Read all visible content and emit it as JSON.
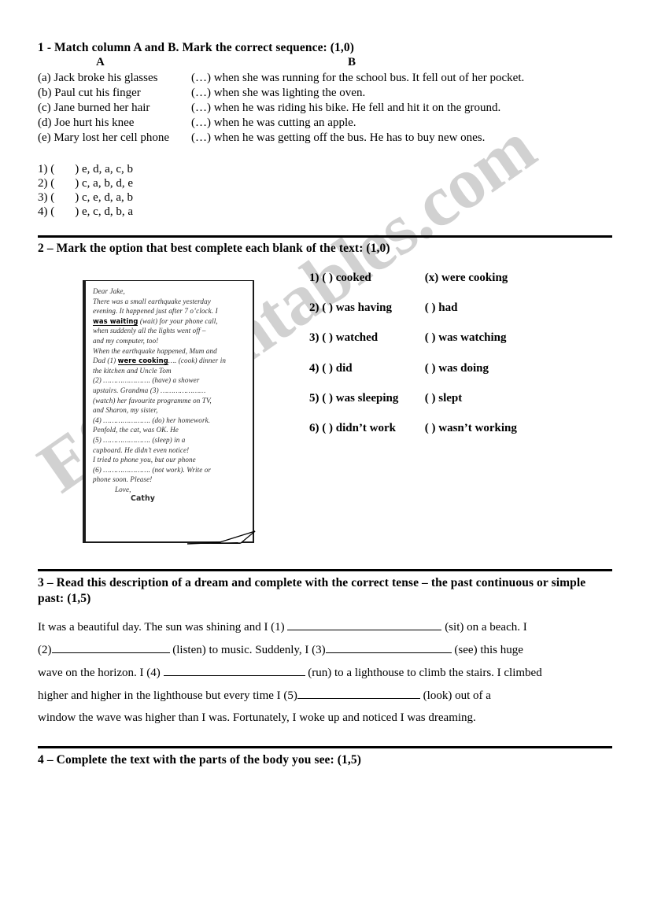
{
  "watermark": {
    "text": "ESLprintables.com"
  },
  "exercise1": {
    "heading": "1 - Match column A and B. Mark the correct sequence: (1,0)",
    "column_a_label": "A",
    "column_b_label": "B",
    "column_a": [
      "(a) Jack broke his glasses",
      "(b) Paul cut his finger",
      "(c) Jane burned her hair",
      "(d) Joe hurt his knee",
      "(e) Mary lost her cell phone"
    ],
    "column_b": [
      "(…) when she was running for the school bus. It fell out of her pocket.",
      "(…) when she was lighting the oven.",
      "(…) when he was riding his bike. He fell and hit it on the ground.",
      "(…) when he was cutting an apple.",
      "(…) when he was getting off the bus. He has to buy new ones."
    ],
    "sequences": [
      {
        "number": "1) (",
        "close": ")",
        "answer": "e, d, a, c, b"
      },
      {
        "number": "2) (",
        "close": ")",
        "answer": "c, a, b, d, e"
      },
      {
        "number": "3) (",
        "close": ")",
        "answer": "c, e, d, a, b"
      },
      {
        "number": "4) (",
        "close": ")",
        "answer": "e, c, d, b, a"
      }
    ]
  },
  "exercise2": {
    "heading": "2 – Mark the option that best complete each blank of the text: (1,0)",
    "letter": {
      "greeting": "Dear Jake,",
      "lines": [
        "There was a small earthquake yesterday",
        "evening. It happened just after 7 o’clock. I"
      ],
      "filled_answer_1": "was waiting",
      "line_after_fill": "(wait) for your phone call,",
      "lines2": [
        "when suddenly all the lights went off –",
        "and my computer, too!",
        "When the earthquake happened, Mum and"
      ],
      "blank1_prefix": "Dad (1)",
      "blank1_answer": "were cooking",
      "blank1_suffix": "…. (cook) dinner in",
      "lines3": [
        "the kitchen and Uncle Tom",
        "(2) …………………. (have) a shower",
        "upstairs. Grandma (3) …………………",
        "(watch) her favourite programme on TV,",
        "and Sharon, my sister,",
        "(4) …………………. (do) her homework.",
        "Penfold, the cat, was OK. He",
        "(5) …………………. (sleep) in a",
        "cupboard. He didn’t even notice!",
        "I tried to phone you, but our phone",
        "(6) …………………. (not work). Write or",
        "phone soon. Please!"
      ],
      "closing": "Love,",
      "signature": "Cathy"
    },
    "options": [
      {
        "number": "1) (",
        "first": ") cooked",
        "second": "(x) were cooking"
      },
      {
        "number": "2) (",
        "first": ") was having",
        "second": "(            ) had"
      },
      {
        "number": "3) (",
        "first": ") watched",
        "second": "(            ) was watching"
      },
      {
        "number": "4) (",
        "first": ") did",
        "second": "(            ) was doing"
      },
      {
        "number": "5) (",
        "first": ") was sleeping",
        "second": "(            ) slept"
      },
      {
        "number": "6) (",
        "first": ") didn’t work",
        "second": "(            ) wasn’t working"
      }
    ]
  },
  "exercise3": {
    "heading": "3 – Read this description of a dream and complete with the correct tense – the past continuous or simple past: (1,5)",
    "line1_a": "It was a beautiful day. The sun was shining and I (1)",
    "line1_b": "(sit) on a beach. I",
    "line2_a": "(2)",
    "line2_b": "(listen) to music. Suddenly, I (3)",
    "line2_c": "(see) this huge",
    "line3_a": "wave on the horizon. I (4)",
    "line3_b": "(run) to a lighthouse to climb the stairs. I climbed",
    "line4_a": "higher and higher in the lighthouse but every time I (5)",
    "line4_b": "(look) out of a",
    "line5": "window the wave was higher than I was. Fortunately, I woke up and noticed I was dreaming."
  },
  "exercise4": {
    "heading": "4 – Complete the text with the parts of the body you see: (1,5)"
  }
}
